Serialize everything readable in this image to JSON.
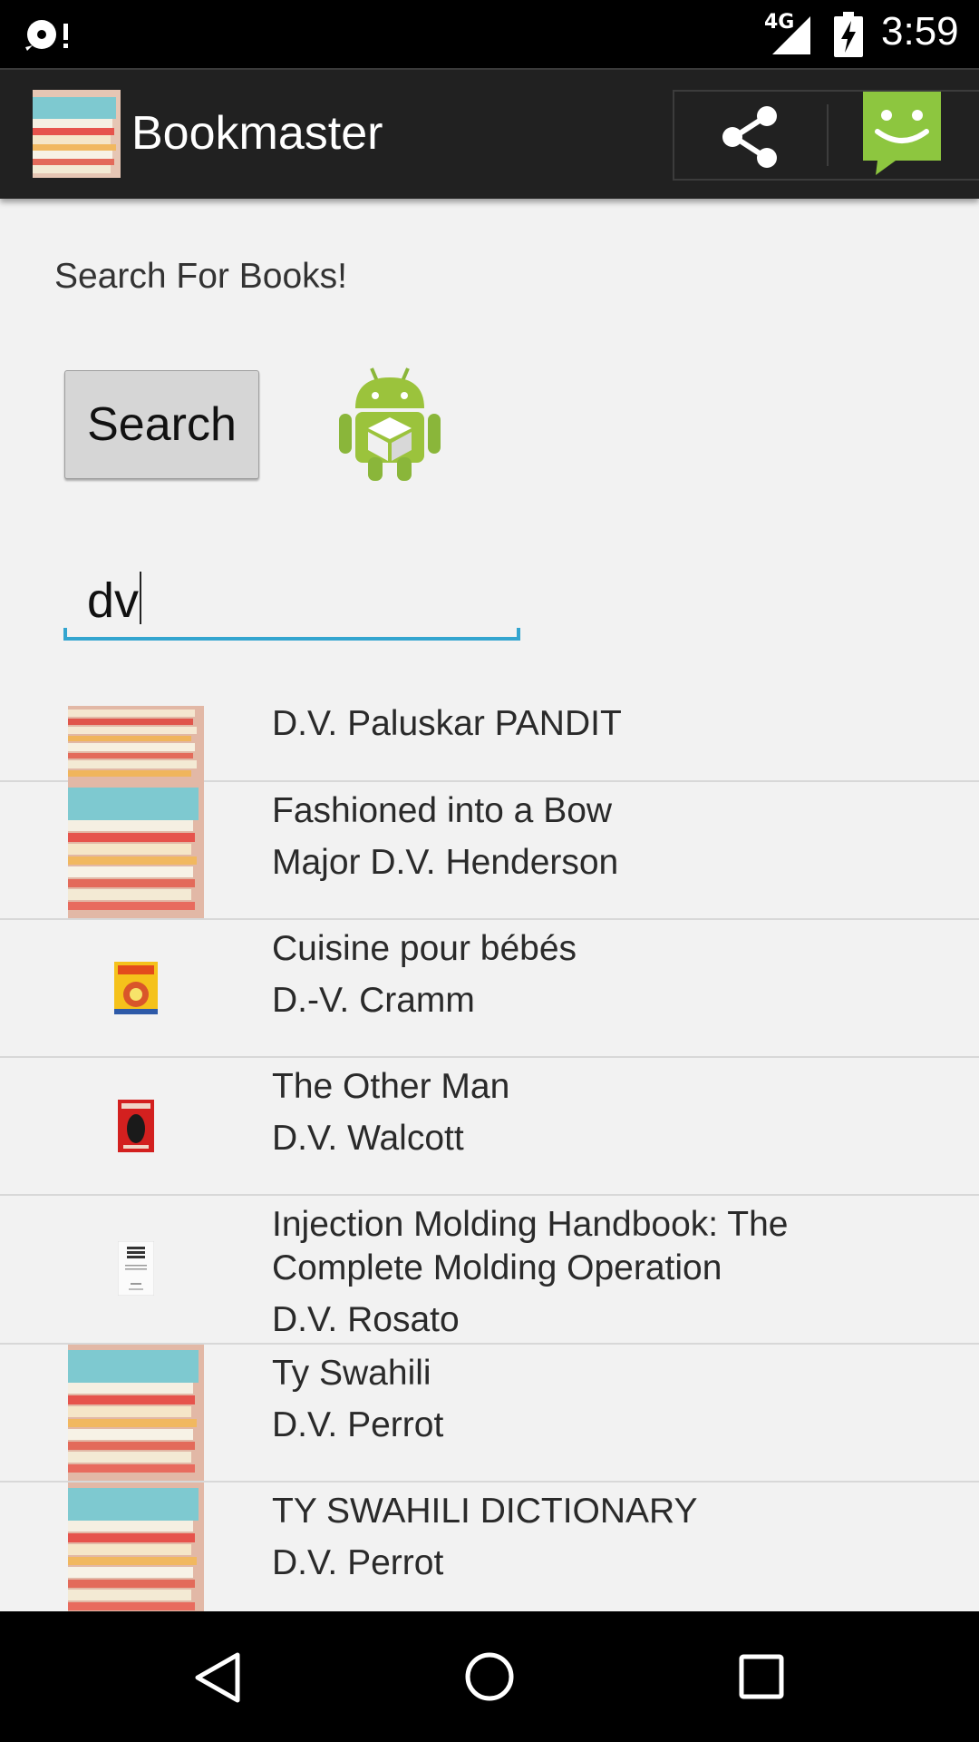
{
  "status_bar": {
    "time": "3:59",
    "network": "4G"
  },
  "app_bar": {
    "title": "Bookmaster"
  },
  "main": {
    "heading": "Search For Books!",
    "search_button_label": "Search",
    "search_input_value": "dv"
  },
  "results": [
    {
      "title": "D.V. Paluskar PANDIT",
      "author": "",
      "thumbnail": "book-stack"
    },
    {
      "title": "Fashioned into a Bow",
      "author": "Major D.V. Henderson",
      "thumbnail": "book-stack"
    },
    {
      "title": "Cuisine pour bébés",
      "author": "D.-V. Cramm",
      "thumbnail": "cover-yellow"
    },
    {
      "title": "The Other Man",
      "author": "D.V. Walcott",
      "thumbnail": "cover-red"
    },
    {
      "title": "Injection Molding Handbook: The Complete Molding Operation",
      "author": "D.V. Rosato",
      "thumbnail": "cover-white"
    },
    {
      "title": "Ty Swahili",
      "author": "D.V. Perrot",
      "thumbnail": "book-stack"
    },
    {
      "title": "TY SWAHILI DICTIONARY",
      "author": "D.V. Perrot",
      "thumbnail": "book-stack"
    }
  ],
  "colors": {
    "accent": "#33a5cf",
    "action_bar": "#212121",
    "chat_green": "#8dc63f",
    "android_green": "#9bc33c"
  }
}
